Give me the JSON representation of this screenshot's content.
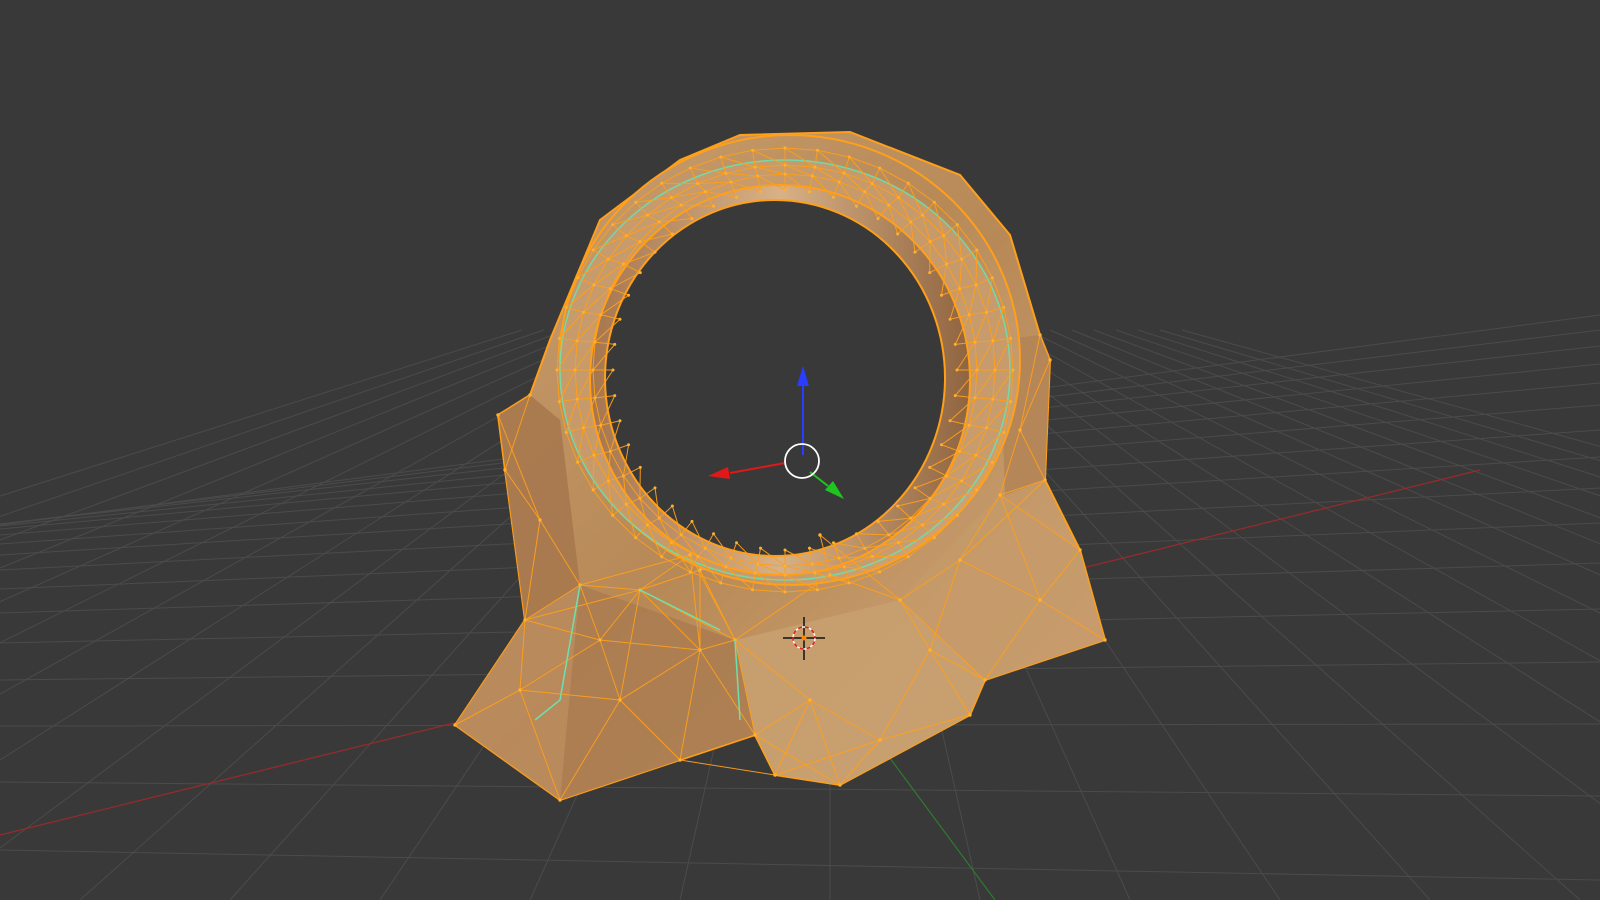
{
  "app": {
    "view": "3d-viewport",
    "mode": "edit-mode",
    "selection": "all-faces-selected"
  },
  "colors": {
    "background": "#393939",
    "grid_line": "#4b4b4b",
    "x_axis": "#9b2a2a",
    "y_axis": "#2f7a2f",
    "mesh_fill": "#c79a6a",
    "mesh_fill_dark": "#9a7048",
    "mesh_wire": "#ff9f1a",
    "seam_edge": "#6ee0b0",
    "gizmo_z": "#2a3cff",
    "gizmo_x": "#e01818",
    "gizmo_y": "#1fc41f"
  },
  "icons": {
    "manipulator": "transform-manipulator-icon",
    "cursor": "3d-cursor-icon"
  }
}
